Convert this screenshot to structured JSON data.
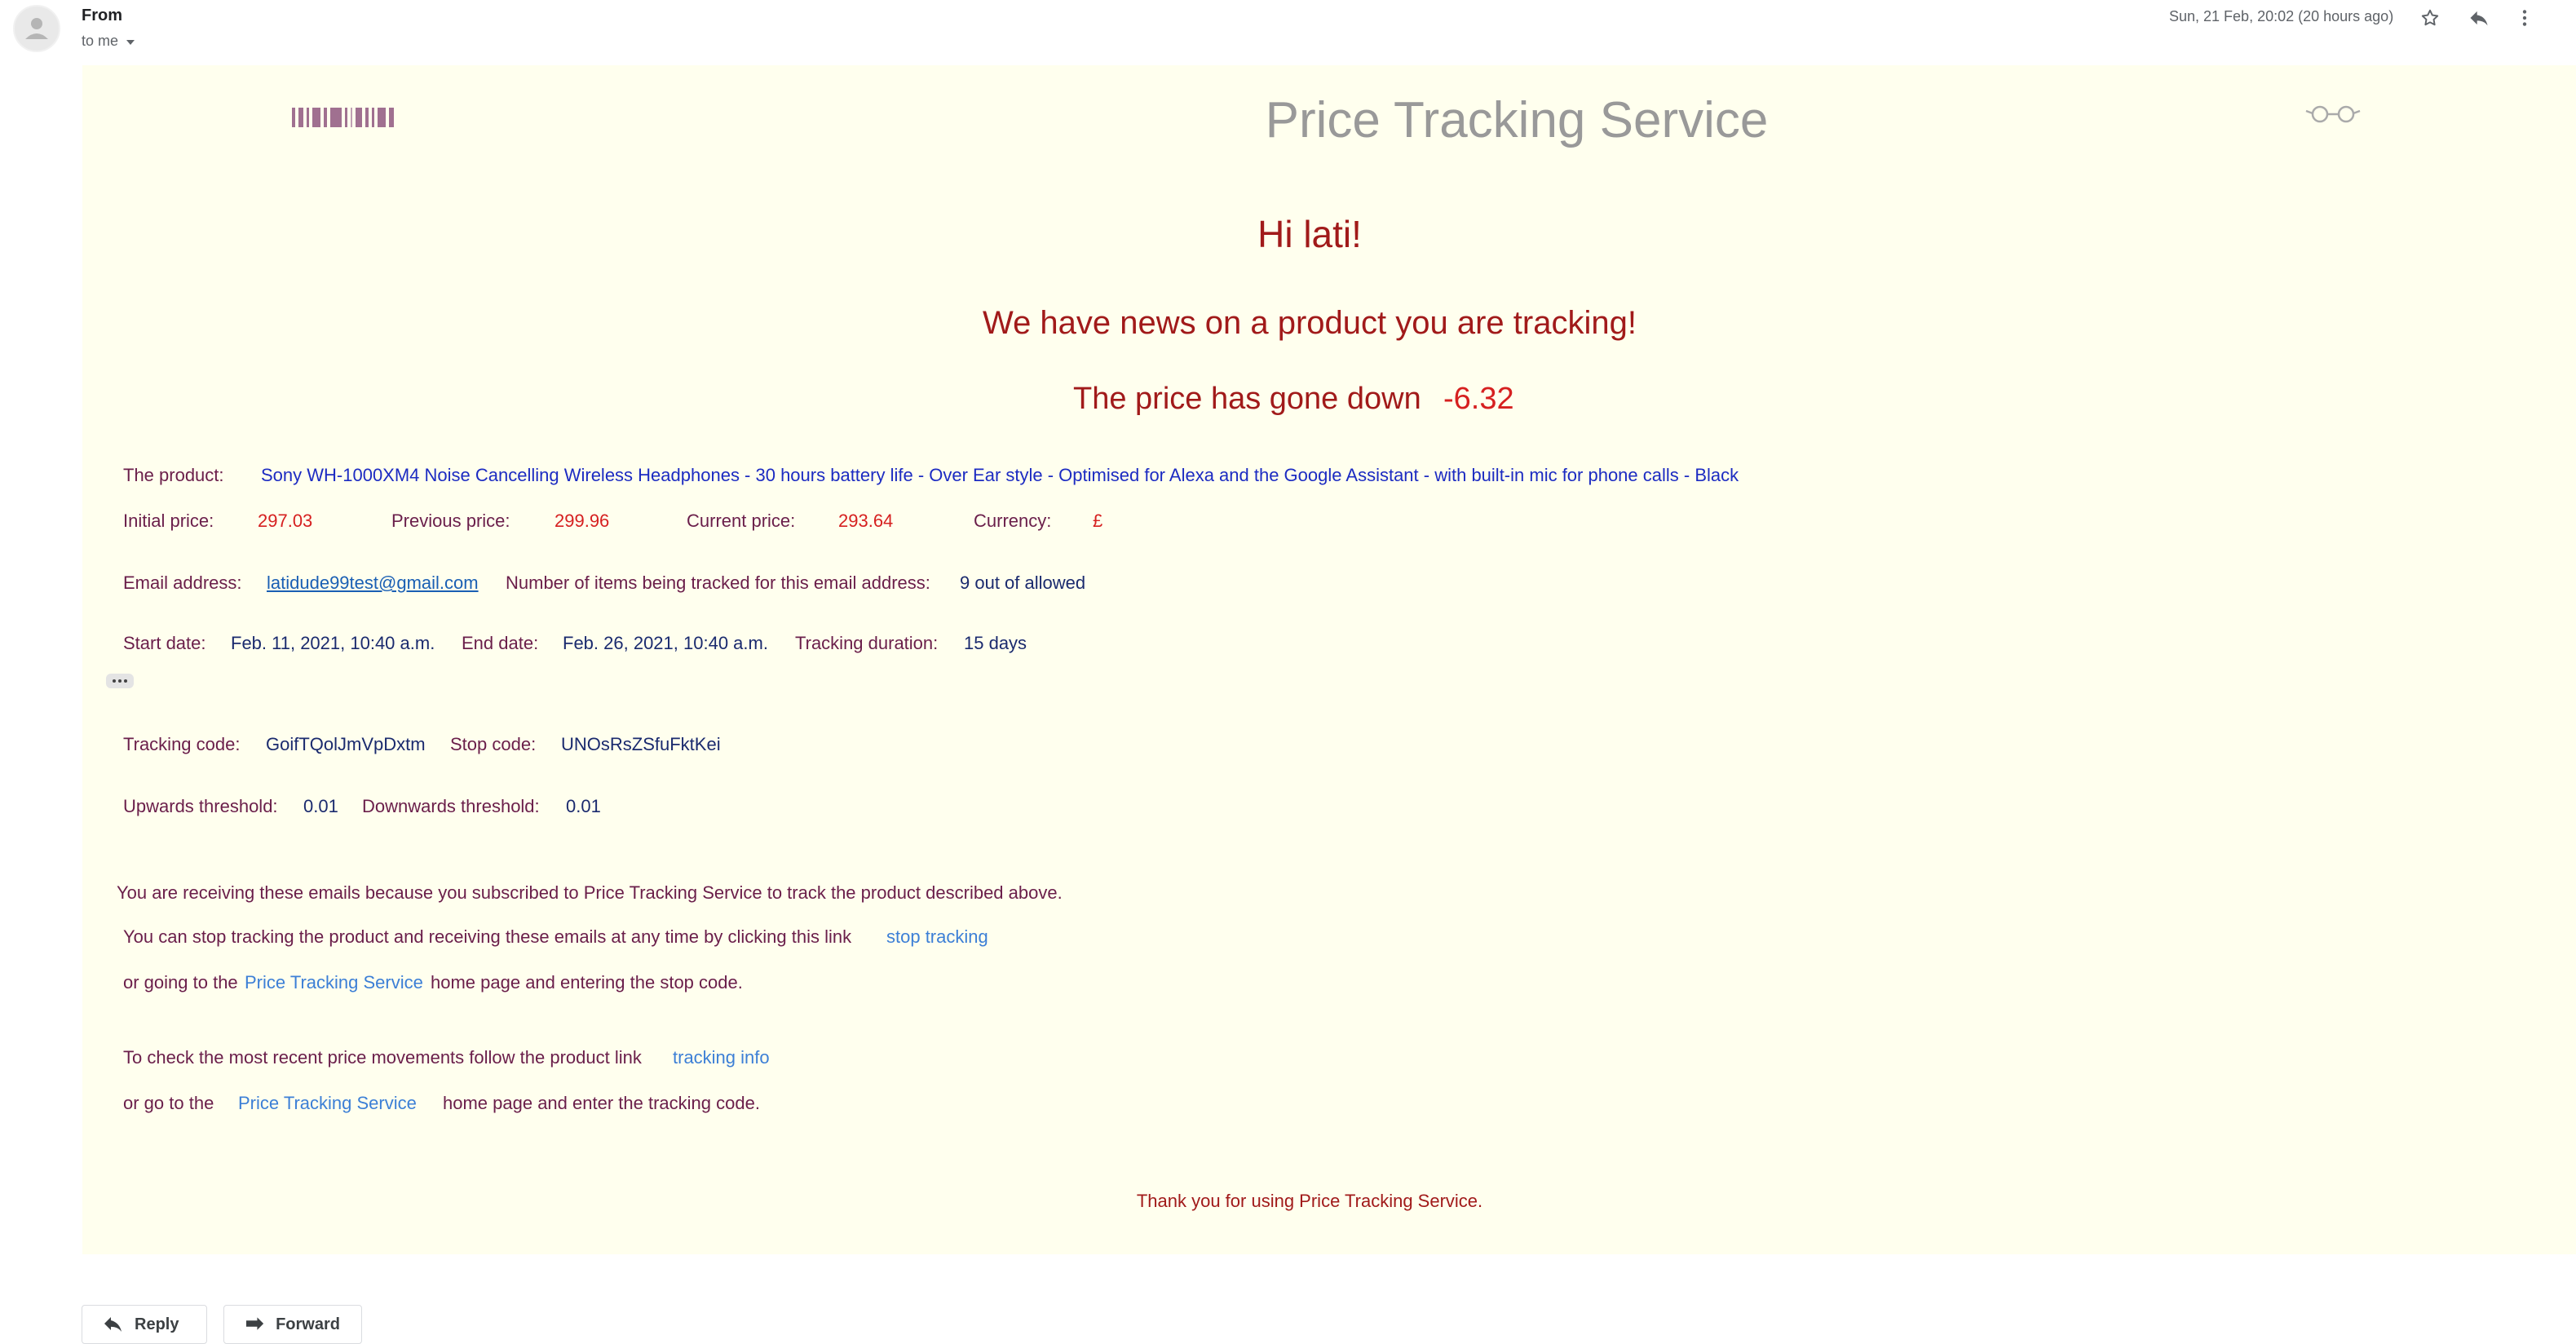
{
  "header": {
    "from_label": "From",
    "to_label": "to me",
    "date": "Sun, 21 Feb, 20:02 (20 hours ago)",
    "icons": [
      "star-icon",
      "reply-icon",
      "more-vert-icon"
    ]
  },
  "email": {
    "brand_title": "Price Tracking Service",
    "greeting": "Hi lati!",
    "news": "We have news on a product you are tracking!",
    "price_change_label": "The price has gone down",
    "price_change_value": "-6.32",
    "product": {
      "label": "The product:",
      "name": "Sony WH-1000XM4 Noise Cancelling Wireless Headphones - 30 hours battery life - Over Ear style - Optimised for Alexa and the Google Assistant - with built-in mic for phone calls - Black"
    },
    "prices": {
      "initial_label": "Initial price:",
      "initial_value": "297.03",
      "previous_label": "Previous price:",
      "previous_value": "299.96",
      "current_label": "Current price:",
      "current_value": "293.64",
      "currency_label": "Currency:",
      "currency_value": "£"
    },
    "email_info": {
      "email_label": "Email address:",
      "email_value": "latidude99test@gmail.com",
      "count_label": "Number of items being tracked for this email address:",
      "count_value": "9 out of allowed"
    },
    "dates": {
      "start_label": "Start date:",
      "start_value": "Feb. 11, 2021, 10:40 a.m.",
      "end_label": "End date:",
      "end_value": "Feb. 26, 2021, 10:40 a.m.",
      "duration_label": "Tracking duration:",
      "duration_value": "15 days"
    },
    "codes": {
      "tracking_label": "Tracking code:",
      "tracking_value": "GoifTQolJmVpDxtm",
      "stop_label": "Stop code:",
      "stop_value": "UNOsRsZSfuFktKei"
    },
    "thresholds": {
      "up_label": "Upwards threshold:",
      "up_value": "0.01",
      "down_label": "Downwards threshold:",
      "down_value": "0.01"
    },
    "footer": {
      "subscribed": "You are receiving these emails because you subscribed to Price Tracking Service to track the product described above.",
      "stop_text": "You can stop tracking the product and receiving these emails at any time by clicking this link",
      "stop_link": "stop tracking",
      "or_going_pre": "or going to the",
      "or_going_link": "Price Tracking Service",
      "or_going_post": "home page and entering the stop code.",
      "check_text": "To check the most recent price movements follow the product link",
      "check_link": "tracking info",
      "or_go_pre": "or go to the",
      "or_go_link": "Price Tracking Service",
      "or_go_post": "home page and enter the tracking code.",
      "thanks": "Thank you for using Price Tracking Service."
    }
  },
  "actions": {
    "reply_label": "Reply",
    "forward_label": "Forward"
  }
}
